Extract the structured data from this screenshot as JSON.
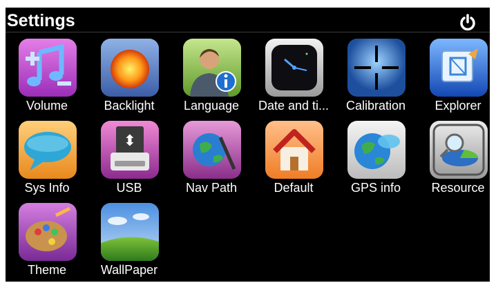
{
  "header": {
    "title": "Settings",
    "power_icon": "power-icon"
  },
  "tiles": [
    {
      "label": "Volume",
      "icon": "music-note-icon"
    },
    {
      "label": "Backlight",
      "icon": "sun-icon"
    },
    {
      "label": "Language",
      "icon": "user-info-icon"
    },
    {
      "label": "Date and ti...",
      "icon": "clock-icon"
    },
    {
      "label": "Calibration",
      "icon": "crosshair-icon"
    },
    {
      "label": "Explorer",
      "icon": "explorer-icon"
    },
    {
      "label": "Sys Info",
      "icon": "speech-bubble-icon"
    },
    {
      "label": "USB",
      "icon": "usb-drive-icon"
    },
    {
      "label": "Nav Path",
      "icon": "globe-magnifier-icon"
    },
    {
      "label": "Default",
      "icon": "home-icon"
    },
    {
      "label": "GPS info",
      "icon": "globe-bubble-icon"
    },
    {
      "label": "Resource",
      "icon": "pie-magnifier-icon"
    },
    {
      "label": "Theme",
      "icon": "palette-icon"
    },
    {
      "label": "WallPaper",
      "icon": "landscape-icon"
    }
  ]
}
